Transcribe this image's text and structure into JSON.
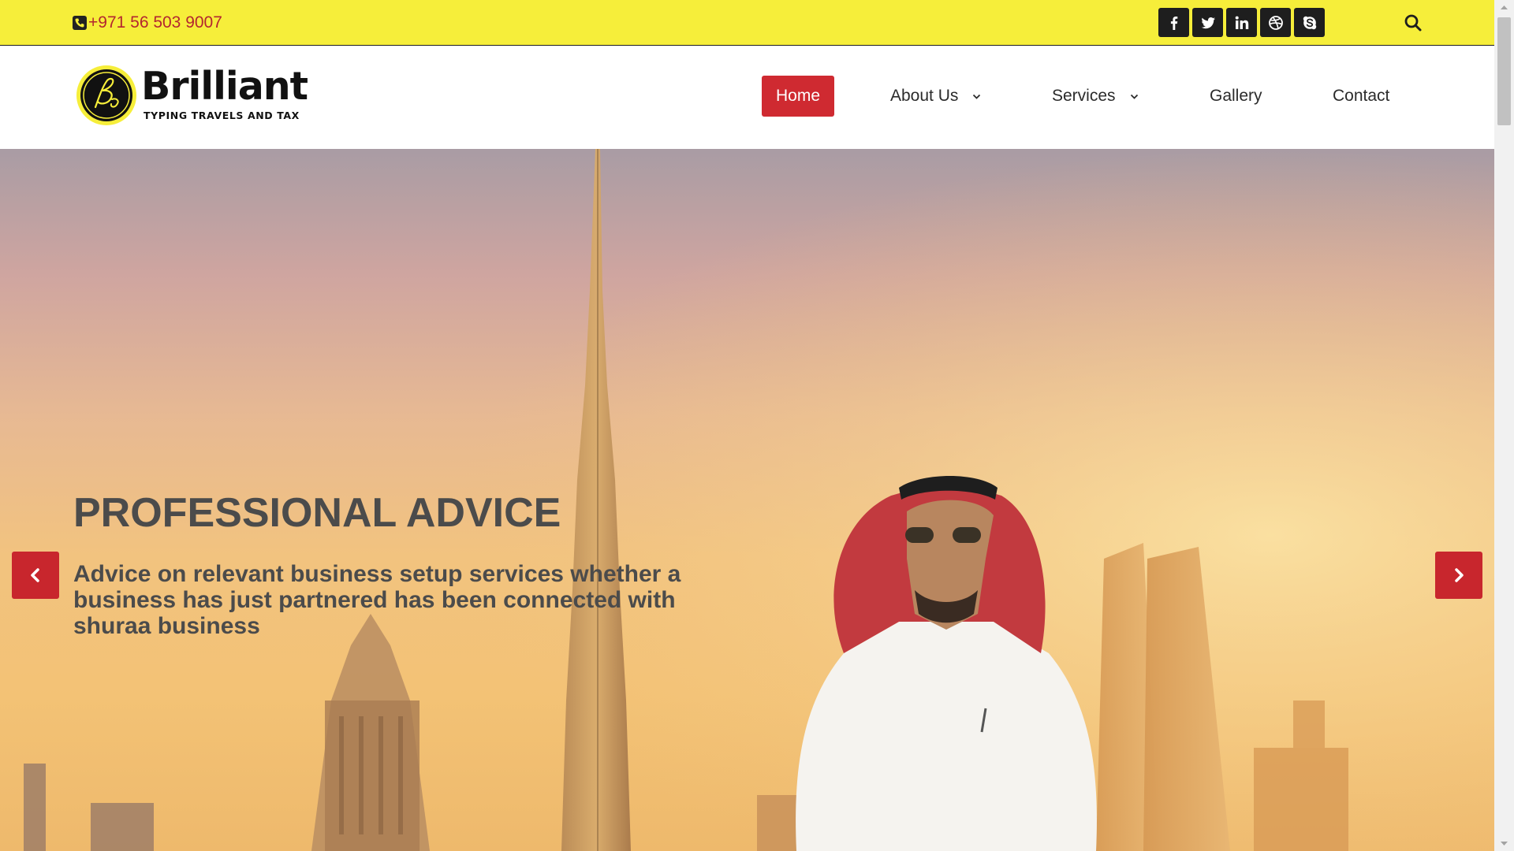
{
  "topbar": {
    "phone": "+971 56 503 9007",
    "social": [
      {
        "name": "facebook",
        "icon": "facebook-icon"
      },
      {
        "name": "twitter",
        "icon": "twitter-icon"
      },
      {
        "name": "linkedin",
        "icon": "linkedin-icon"
      },
      {
        "name": "dribbble",
        "icon": "dribbble-icon"
      },
      {
        "name": "skype",
        "icon": "skype-icon"
      }
    ],
    "search_icon": "search-icon"
  },
  "brand": {
    "name": "Brilliant",
    "tagline": "TYPING TRAVELS AND TAX"
  },
  "nav": {
    "home": "Home",
    "about": "About Us",
    "services": "Services",
    "gallery": "Gallery",
    "contact": "Contact",
    "active": "Home"
  },
  "hero": {
    "title": "PROFESSIONAL ADVICE",
    "description": "Advice on relevant business setup services whether a business has just partnered has been connected with shuraa business",
    "prev_icon": "chevron-left-icon",
    "next_icon": "chevron-right-icon"
  },
  "colors": {
    "topbar_bg": "#f6ee3a",
    "accent_red": "#cf2a31",
    "phone_text": "#b3262f",
    "hero_text": "#4b4b4b"
  }
}
